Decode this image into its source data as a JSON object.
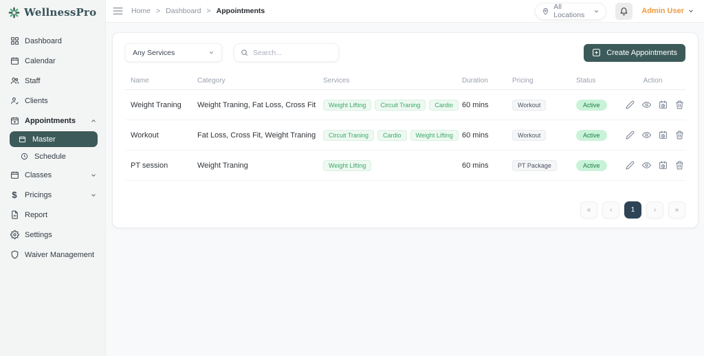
{
  "brand": {
    "name": "WellnessPro"
  },
  "topbar": {
    "breadcrumb_home": "Home",
    "breadcrumb_dashboard": "Dashboard",
    "breadcrumb_current": "Appointments",
    "separator": ">",
    "location": "All Locations",
    "user": "Admin User"
  },
  "sidebar": {
    "items": [
      {
        "label": "Dashboard"
      },
      {
        "label": "Calendar"
      },
      {
        "label": "Staff"
      },
      {
        "label": "Clients"
      },
      {
        "label": "Appointments"
      },
      {
        "label": "Master"
      },
      {
        "label": "Schedule"
      },
      {
        "label": "Classes"
      },
      {
        "label": "Pricings"
      },
      {
        "label": "Report"
      },
      {
        "label": "Settings"
      },
      {
        "label": "Waiver Management"
      }
    ]
  },
  "filters": {
    "service_filter": "Any Services",
    "search_placeholder": "Search..."
  },
  "create_button_label": "Create Appointments",
  "table": {
    "columns": [
      "Name",
      "Category",
      "Services",
      "Duration",
      "Pricing",
      "Status",
      "Action"
    ],
    "rows": [
      {
        "name": "Weight Traning",
        "category": "Weight Traning, Fat Loss, Cross Fit",
        "services": [
          "Weight Lifting",
          "Circuit Traning",
          "Cardio"
        ],
        "duration": "60 mins",
        "pricing": "Workout",
        "status": "Active"
      },
      {
        "name": "Workout",
        "category": "Fat Loss, Cross Fit, Weight Traning",
        "services": [
          "Circuit Traning",
          "Cardio",
          "Weight Lifting"
        ],
        "duration": "60 mins",
        "pricing": "Workout",
        "status": "Active"
      },
      {
        "name": "PT session",
        "category": "Weight Traning",
        "services": [
          "Weight Lifting"
        ],
        "duration": "60 mins",
        "pricing": "PT Package",
        "status": "Active"
      }
    ]
  },
  "pagination": {
    "first": "«",
    "prev": "‹",
    "page": "1",
    "next": "›",
    "last": "»"
  },
  "colors": {
    "brand_teal": "#3d5a5a",
    "sidebar_active_bg": "#3d5a5a",
    "pagination_active_bg": "#2e4356",
    "user_orange": "#ef9b42",
    "service_badge_text": "#3ba968",
    "service_badge_bg": "#edf9f1",
    "status_active_bg": "#c9f3d8",
    "status_active_text": "#1e7a4c"
  }
}
